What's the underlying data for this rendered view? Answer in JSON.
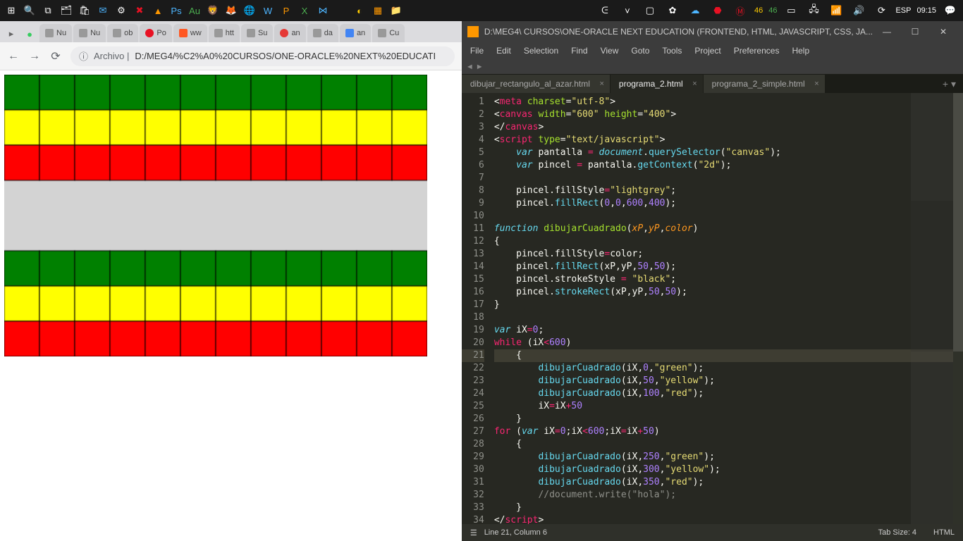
{
  "taskbar": {
    "right_badges": [
      "46",
      "46"
    ],
    "lang": "ESP",
    "time": "09:15"
  },
  "chrome": {
    "tabs": [
      "Nu",
      "Nu",
      "ob",
      "Po",
      "ww",
      "htt",
      "Su",
      "an",
      "da",
      "an",
      "Cu"
    ],
    "url_prefix": "Archivo |",
    "url": "D:/MEG4/%C2%A0%20CURSOS/ONE-ORACLE%20NEXT%20EDUCATI"
  },
  "sublime": {
    "title": "D:\\MEG4\\  CURSOS\\ONE-ORACLE NEXT EDUCATION (FRONTEND, HTML, JAVASCRIPT, CSS, JA...",
    "menus": [
      "File",
      "Edit",
      "Selection",
      "Find",
      "View",
      "Goto",
      "Tools",
      "Project",
      "Preferences",
      "Help"
    ],
    "tabs": [
      {
        "label": "dibujar_rectangulo_al_azar.html",
        "active": false
      },
      {
        "label": "programa_2.html",
        "active": true
      },
      {
        "label": "programa_2_simple.html",
        "active": false
      }
    ],
    "status_left": "Line 21, Column 6",
    "status_tab": "Tab Size: 4",
    "status_lang": "HTML"
  },
  "code": {
    "lines": [
      {
        "n": 1,
        "h": "<span class='k-white'>&lt;</span><span class='k-pink'>meta</span> <span class='k-green'>charset</span><span class='k-white'>=</span><span class='k-yellow'>\"utf-8\"</span><span class='k-white'>&gt;</span>"
      },
      {
        "n": 2,
        "h": "<span class='k-white'>&lt;</span><span class='k-pink'>canvas</span> <span class='k-green'>width</span><span class='k-white'>=</span><span class='k-yellow'>\"600\"</span> <span class='k-green'>height</span><span class='k-white'>=</span><span class='k-yellow'>\"400\"</span><span class='k-white'>&gt;</span>"
      },
      {
        "n": 3,
        "h": "<span class='k-white'>&lt;/</span><span class='k-pink'>canvas</span><span class='k-white'>&gt;</span>"
      },
      {
        "n": 4,
        "h": "<span class='k-white'>&lt;</span><span class='k-pink'>script</span> <span class='k-green'>type</span><span class='k-white'>=</span><span class='k-yellow'>\"text/javascript\"</span><span class='k-white'>&gt;</span>"
      },
      {
        "n": 5,
        "h": "    <span class='k-blue'>var</span> <span class='k-white'>pantalla </span><span class='k-pink'>=</span> <span class='k-blue'>document</span><span class='k-white'>.</span><span class='k-teal'>querySelector</span><span class='k-white'>(</span><span class='k-yellow'>\"canvas\"</span><span class='k-white'>);</span>"
      },
      {
        "n": 6,
        "h": "    <span class='k-blue'>var</span> <span class='k-white'>pincel </span><span class='k-pink'>=</span> <span class='k-white'>pantalla.</span><span class='k-teal'>getContext</span><span class='k-white'>(</span><span class='k-yellow'>\"2d\"</span><span class='k-white'>);</span>"
      },
      {
        "n": 7,
        "h": ""
      },
      {
        "n": 8,
        "h": "    <span class='k-white'>pincel.fillStyle</span><span class='k-pink'>=</span><span class='k-yellow'>\"lightgrey\"</span><span class='k-white'>;</span>"
      },
      {
        "n": 9,
        "h": "    <span class='k-white'>pincel.</span><span class='k-teal'>fillRect</span><span class='k-white'>(</span><span class='k-purple'>0</span><span class='k-white'>,</span><span class='k-purple'>0</span><span class='k-white'>,</span><span class='k-purple'>600</span><span class='k-white'>,</span><span class='k-purple'>400</span><span class='k-white'>);</span>"
      },
      {
        "n": 10,
        "h": ""
      },
      {
        "n": 11,
        "h": "<span class='k-blue'>function</span> <span class='k-green'>dibujarCuadrado</span><span class='k-white'>(</span><span class='k-orange'>xP</span><span class='k-white'>,</span><span class='k-orange'>yP</span><span class='k-white'>,</span><span class='k-orange'>color</span><span class='k-white'>)</span>"
      },
      {
        "n": 12,
        "h": "<span class='k-white'>{</span>"
      },
      {
        "n": 13,
        "h": "    <span class='k-white'>pincel.fillStyle</span><span class='k-pink'>=</span><span class='k-white'>color;</span>"
      },
      {
        "n": 14,
        "h": "    <span class='k-white'>pincel.</span><span class='k-teal'>fillRect</span><span class='k-white'>(xP,yP,</span><span class='k-purple'>50</span><span class='k-white'>,</span><span class='k-purple'>50</span><span class='k-white'>);</span>"
      },
      {
        "n": 15,
        "h": "    <span class='k-white'>pincel.strokeStyle </span><span class='k-pink'>=</span> <span class='k-yellow'>\"black\"</span><span class='k-white'>;</span>"
      },
      {
        "n": 16,
        "h": "    <span class='k-white'>pincel.</span><span class='k-teal'>strokeRect</span><span class='k-white'>(xP,yP,</span><span class='k-purple'>50</span><span class='k-white'>,</span><span class='k-purple'>50</span><span class='k-white'>);</span>"
      },
      {
        "n": 17,
        "h": "<span class='k-white'>}</span>"
      },
      {
        "n": 18,
        "h": ""
      },
      {
        "n": 19,
        "h": "<span class='k-blue'>var</span> <span class='k-white'>iX</span><span class='k-pink'>=</span><span class='k-purple'>0</span><span class='k-white'>;</span>"
      },
      {
        "n": 20,
        "h": "<span class='k-pink'>while</span> <span class='k-white'>(iX</span><span class='k-pink'>&lt;</span><span class='k-purple'>600</span><span class='k-white'>)</span>"
      },
      {
        "n": 21,
        "h": "    <span class='k-white'>{</span>",
        "cursor": true
      },
      {
        "n": 22,
        "h": "        <span class='k-teal'>dibujarCuadrado</span><span class='k-white'>(iX,</span><span class='k-purple'>0</span><span class='k-white'>,</span><span class='k-yellow'>\"green\"</span><span class='k-white'>);</span>"
      },
      {
        "n": 23,
        "h": "        <span class='k-teal'>dibujarCuadrado</span><span class='k-white'>(iX,</span><span class='k-purple'>50</span><span class='k-white'>,</span><span class='k-yellow'>\"yellow\"</span><span class='k-white'>);</span>"
      },
      {
        "n": 24,
        "h": "        <span class='k-teal'>dibujarCuadrado</span><span class='k-white'>(iX,</span><span class='k-purple'>100</span><span class='k-white'>,</span><span class='k-yellow'>\"red\"</span><span class='k-white'>);</span>"
      },
      {
        "n": 25,
        "h": "        <span class='k-white'>iX</span><span class='k-pink'>=</span><span class='k-white'>iX</span><span class='k-pink'>+</span><span class='k-purple'>50</span>"
      },
      {
        "n": 26,
        "h": "    <span class='k-white'>}</span>"
      },
      {
        "n": 27,
        "h": "<span class='k-pink'>for</span> <span class='k-white'>(</span><span class='k-blue'>var</span> <span class='k-white'>iX</span><span class='k-pink'>=</span><span class='k-purple'>0</span><span class='k-white'>;iX</span><span class='k-pink'>&lt;</span><span class='k-purple'>600</span><span class='k-white'>;iX</span><span class='k-pink'>=</span><span class='k-white'>iX</span><span class='k-pink'>+</span><span class='k-purple'>50</span><span class='k-white'>)</span>"
      },
      {
        "n": 28,
        "h": "    <span class='k-white'>{</span>"
      },
      {
        "n": 29,
        "h": "        <span class='k-teal'>dibujarCuadrado</span><span class='k-white'>(iX,</span><span class='k-purple'>250</span><span class='k-white'>,</span><span class='k-yellow'>\"green\"</span><span class='k-white'>);</span>"
      },
      {
        "n": 30,
        "h": "        <span class='k-teal'>dibujarCuadrado</span><span class='k-white'>(iX,</span><span class='k-purple'>300</span><span class='k-white'>,</span><span class='k-yellow'>\"yellow\"</span><span class='k-white'>);</span>"
      },
      {
        "n": 31,
        "h": "        <span class='k-teal'>dibujarCuadrado</span><span class='k-white'>(iX,</span><span class='k-purple'>350</span><span class='k-white'>,</span><span class='k-yellow'>\"red\"</span><span class='k-white'>);</span>"
      },
      {
        "n": 32,
        "h": "        <span class='k-grey'>//document.write(\"hola\");</span>"
      },
      {
        "n": 33,
        "h": "    <span class='k-white'>}</span>"
      },
      {
        "n": 34,
        "h": "<span class='k-white'>&lt;/</span><span class='k-pink'>script</span><span class='k-white'>&gt;</span>"
      }
    ]
  }
}
